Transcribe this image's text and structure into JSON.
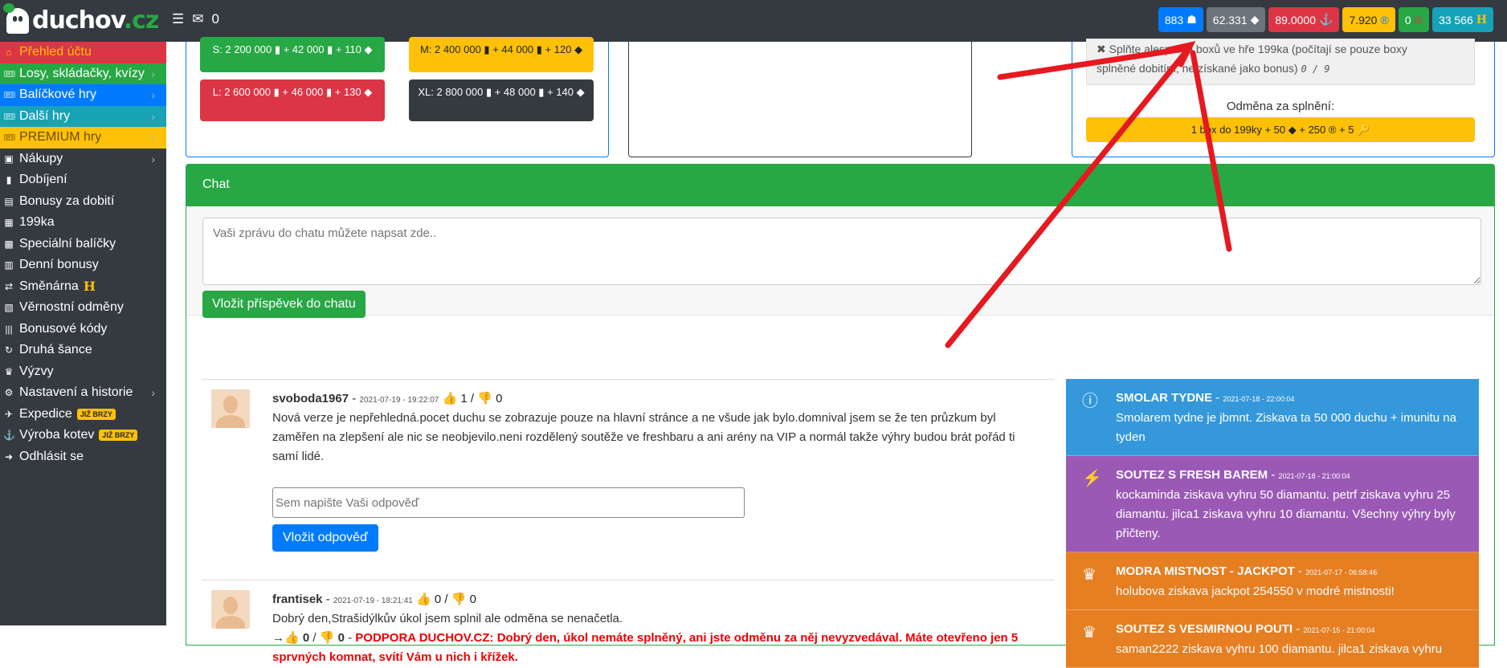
{
  "brand": {
    "name": "duchov",
    "tld": ".cz"
  },
  "topbar": {
    "menu_icon": "hamburger-icon",
    "mail_count": "0"
  },
  "badges": [
    {
      "value": "883",
      "icon": "ghost-icon",
      "color": "#007bff"
    },
    {
      "value": "62.331",
      "icon": "diamond-icon",
      "color": "#6c757d"
    },
    {
      "value": "89.0000",
      "icon": "anchor-icon",
      "color": "#dc3545"
    },
    {
      "value": "7.920",
      "icon": "r-coin-icon",
      "color": "#ffc107"
    },
    {
      "value": "0",
      "icon": "r-coin-icon",
      "color": "#28a745"
    },
    {
      "value": "33 566",
      "icon": "h-icon",
      "color": "#17a2b8"
    }
  ],
  "sidebar": {
    "items": [
      {
        "label": "Přehled účtu",
        "icon": "home-icon"
      },
      {
        "label": "Losy, skládačky, kvízy",
        "icon": "ticket-icon"
      },
      {
        "label": "Balíčkové hry",
        "icon": "ticket-icon"
      },
      {
        "label": "Další hry",
        "icon": "ticket-icon"
      },
      {
        "label": "PREMIUM hry",
        "icon": "ticket-icon"
      },
      {
        "label": "Nákupy",
        "icon": "cart-icon"
      },
      {
        "label": "Dobíjení",
        "icon": "battery-icon"
      },
      {
        "label": "Bonusy za dobití",
        "icon": "gift-icon"
      },
      {
        "label": "199ka",
        "icon": "grid-icon"
      },
      {
        "label": "Speciální balíčky",
        "icon": "box-icon"
      },
      {
        "label": "Denní bonusy",
        "icon": "calendar-icon"
      },
      {
        "label": "Směnárna",
        "icon": "exchange-icon"
      },
      {
        "label": "Věrnostní odměny",
        "icon": "award-icon"
      },
      {
        "label": "Bonusové kódy",
        "icon": "barcode-icon"
      },
      {
        "label": "Druhá šance",
        "icon": "retry-icon"
      },
      {
        "label": "Výzvy",
        "icon": "trophy-icon"
      },
      {
        "label": "Nastavení a historie",
        "icon": "gear-icon"
      },
      {
        "label": "Expedice",
        "icon": "compass-icon",
        "badge": "JIŽ BRZY"
      },
      {
        "label": "Výroba kotev",
        "icon": "anchor-icon",
        "badge": "JIŽ BRZY"
      },
      {
        "label": "Odhlásit se",
        "icon": "logout-icon"
      }
    ],
    "smenarna_symbol": "H"
  },
  "packages": {
    "s": "S: 2 200 000 ▮ + 42 000 ▮ + 110",
    "m": "M: 2 400 000 ▮ + 44 000 ▮ + 120",
    "l": "L: 2 600 000 ▮ + 46 000 ▮ + 130",
    "xl": "XL: 2 800 000 ▮ + 48 000 ▮ + 140"
  },
  "task": {
    "text_line1": "✖ Splňte alespoň 9 boxů ve hře 199ka (počítají se pouze boxy",
    "text_line2": "splněné dobitím, ne získané jako bonus)",
    "progress": "0 / 9",
    "reward_title": "Odměna za splnění:",
    "reward": "1 box do 199ky + 50 ◆ + 250 ® + 5 🔑"
  },
  "chat": {
    "title": "Chat",
    "placeholder": "Vaši zprávu do chatu můžete napsat zde..",
    "submit_label": "Vložit příspěvek do chatu",
    "reply_placeholder": "Sem napište Vaši odpověď",
    "reply_button": "Vložit odpověď",
    "posts": [
      {
        "user": "svoboda1967",
        "time": "2021-07-19 - 19:22:07",
        "likes": "1",
        "dislikes": "0",
        "text": "Nová verze je nepřehledná.pocet duchu se zobrazuje pouze na hlavní stránce a ne všude jak bylo.domnival jsem se že ten průzkum byl zaměřen na zlepšení ale nic se neobjevilo.neni rozdělený soutěže ve freshbaru a ani arény na VIP a normál takže výhry budou brát pořád ti samí lidé."
      },
      {
        "user": "frantisek",
        "time": "2021-07-19 - 18:21:41",
        "likes": "0",
        "dislikes": "0",
        "text": "Dobrý den,Strašidýlkův úkol jsem splnil ale odměna se nenačetla.",
        "reply_likes": "0",
        "reply_dislikes": "0",
        "reply_author": "PODPORA DUCHOV.CZ",
        "reply_text": "Dobrý den, úkol nemáte splněný, ani jste odměnu za něj nevyzvedával. Máte otevřeno jen 5 sprvných komnat, svítí Vám u nich i křížek."
      }
    ]
  },
  "news": [
    {
      "title": "SMOLAR TYDNE",
      "time": "2021-07-18 - 22:00:04",
      "text": "Smolarem tydne je jbmnt. Ziskava ta 50 000 duchu + imunitu na tyden",
      "icon": "info-icon",
      "color": "#3498db"
    },
    {
      "title": "SOUTEZ S FRESH BAREM",
      "time": "2021-07-18 - 21:00:04",
      "text": "kockaminda ziskava vyhru 50 diamantu. petrf ziskava vyhru 25 diamantu. jilca1 ziskava vyhru 10 diamantu. Všechny výhry byly přičteny.",
      "icon": "bolt-icon",
      "color": "#9b59b6"
    },
    {
      "title": "MODRA MISTNOST - JACKPOT",
      "time": "2021-07-17 - 06:58:46",
      "text": "holubova ziskava jackpot 254550 v modré mistnosti!",
      "icon": "trophy-icon",
      "color": "#e67e22"
    },
    {
      "title": "SOUTEZ S VESMIRNOU POUTI",
      "time": "2021-07-15 - 21:00:04",
      "text": "saman2222 ziskava vyhru 100 diamantu. jilca1 ziskava vyhru",
      "icon": "trophy-icon",
      "color": "#e67e22"
    }
  ]
}
